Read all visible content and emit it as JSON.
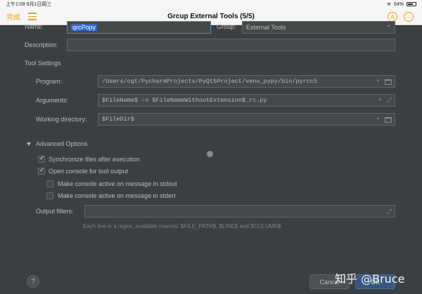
{
  "statusbar": {
    "time_date": "上午1:09   9月1日周三",
    "battery": "64%"
  },
  "navbar": {
    "done_label": "完成",
    "title": "Grcup External Tools (5/5)",
    "a_label": "A",
    "more_label": "···"
  },
  "form": {
    "name_label": "Name:",
    "name_value": "qrcPopy",
    "group_label": "Group:",
    "group_value": "External Tools",
    "description_label": "Description:",
    "description_value": ""
  },
  "tool_settings": {
    "header": "Tool Settings",
    "program_label": "Program:",
    "program_value": "/Users/cgt/PycharmProjects/PyQt5Project/venv_pypy/bin/pyrcc5",
    "arguments_label": "Arguments:",
    "arguments_value": "$FileName$ -o $FileNameWithoutExtension$_rc.py",
    "workdir_label": "Working directory:",
    "workdir_value": "$FileDir$"
  },
  "advanced": {
    "header": "Advanced Options",
    "options": [
      {
        "label": "Synchronize files after execution",
        "checked": true
      },
      {
        "label": "Open console for tool output",
        "checked": true
      },
      {
        "label": "Make console active on message in stdout",
        "checked": false
      },
      {
        "label": "Make console active on message in stderr",
        "checked": false
      }
    ],
    "output_filters_label": "Output filters:",
    "output_filters_value": "",
    "hint": "Each line is a regex, available macros: $FILE_PATH$, $LINE$ and $COLUMN$"
  },
  "footer": {
    "help_label": "?",
    "cancel_label": "Cancel",
    "ok_label": "OK"
  },
  "watermark": "知乎 @Bruce",
  "colors": {
    "background": "#3c3f41",
    "field": "#45494a",
    "accent": "#f0a30a",
    "selection": "#2f65ca",
    "ok_button": "#365880"
  }
}
